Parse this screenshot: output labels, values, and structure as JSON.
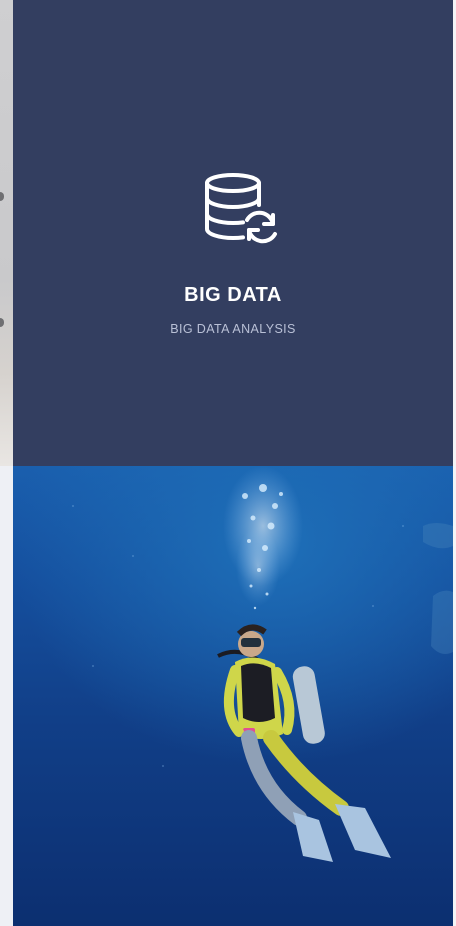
{
  "card": {
    "icon": "database-sync-icon",
    "title": "BIG DATA",
    "subtitle": "BIG DATA ANALYSIS",
    "background_color": "#333e60"
  },
  "photo": {
    "subject": "scuba-diver-underwater-image"
  }
}
